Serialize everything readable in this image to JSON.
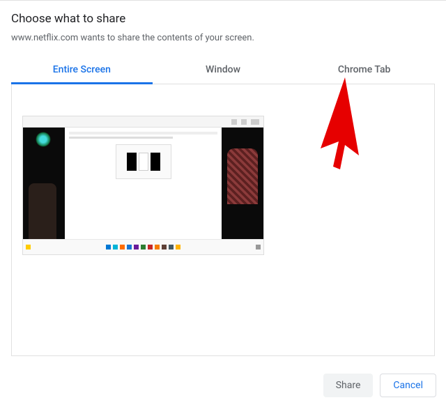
{
  "dialog": {
    "title": "Choose what to share",
    "subtitle": "www.netflix.com wants to share the contents of your screen."
  },
  "tabs": {
    "entire_screen": "Entire Screen",
    "window": "Window",
    "chrome_tab": "Chrome Tab"
  },
  "buttons": {
    "share": "Share",
    "cancel": "Cancel"
  }
}
